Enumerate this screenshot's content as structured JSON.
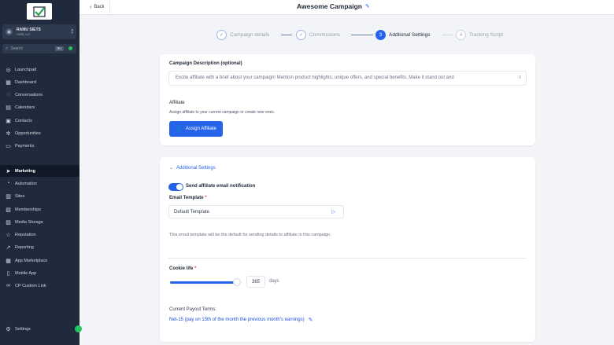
{
  "sidebar": {
    "account": {
      "name": "RAMU SIETS",
      "location": "Ariel, LA"
    },
    "search": {
      "placeholder": "Search",
      "shortcut": "⌘K"
    },
    "items": [
      {
        "label": "Launchpad",
        "icon": "rocket-icon",
        "glyph": "◎"
      },
      {
        "label": "Dashboard",
        "icon": "dashboard-icon",
        "glyph": "▦"
      },
      {
        "label": "Conversations",
        "icon": "chat-icon",
        "glyph": "◌"
      },
      {
        "label": "Calendars",
        "icon": "calendar-icon",
        "glyph": "▤"
      },
      {
        "label": "Contacts",
        "icon": "contacts-icon",
        "glyph": "▣"
      },
      {
        "label": "Opportunities",
        "icon": "opportunities-icon",
        "glyph": "✲"
      },
      {
        "label": "Payments",
        "icon": "payments-icon",
        "glyph": "▭"
      },
      {
        "label": "Marketing",
        "icon": "send-icon",
        "glyph": "➤"
      },
      {
        "label": "Automation",
        "icon": "automation-icon",
        "glyph": "◔"
      },
      {
        "label": "Sites",
        "icon": "sites-icon",
        "glyph": "▥"
      },
      {
        "label": "Memberships",
        "icon": "memberships-icon",
        "glyph": "▧"
      },
      {
        "label": "Media Storage",
        "icon": "media-icon",
        "glyph": "▨"
      },
      {
        "label": "Reputation",
        "icon": "star-icon",
        "glyph": "☆"
      },
      {
        "label": "Reporting",
        "icon": "chart-icon",
        "glyph": "↗"
      },
      {
        "label": "App Marketplace",
        "icon": "marketplace-icon",
        "glyph": "▦"
      },
      {
        "label": "Mobile App",
        "icon": "mobile-icon",
        "glyph": "▯"
      },
      {
        "label": "CP Custom Link",
        "icon": "link-icon",
        "glyph": "∞"
      }
    ],
    "settings": {
      "label": "Settings",
      "icon": "gear-icon",
      "glyph": "⚙"
    }
  },
  "topbar": {
    "back_label": "Back",
    "title": "Awesome Campaign"
  },
  "stepper": [
    {
      "label": "Campaign details",
      "state": "done",
      "marker": "✓"
    },
    {
      "label": "Commissions",
      "state": "done",
      "marker": "✓"
    },
    {
      "label": "Addtional Settings",
      "state": "current",
      "marker": "3"
    },
    {
      "label": "Tracking Script",
      "state": "pending",
      "marker": "4"
    }
  ],
  "description": {
    "label": "Campaign Description (optional)",
    "placeholder": "Excite affiliate with a brief about your campaign! Mention product highlights, unique offers, and special benefits. Make it stand out and",
    "count": "0"
  },
  "affiliate": {
    "label": "Affiliate",
    "subtitle": "Assign affiliate to your current campaign or create new ones.",
    "button_label": "Assign Affiliate"
  },
  "additional": {
    "toggle_label": "Additional Settings",
    "notify_label": "Send affiliate email notification",
    "notify_enabled": true,
    "template_label": "Email Template",
    "required_mark": "*",
    "template_value": "Default Template",
    "help_text": "This email template will be the default for sending details to affiliate in this campaign.",
    "cookie_label": "Cookie life",
    "cookie_value": "365",
    "cookie_unit": "days",
    "payout_label": "Current Payout Terms:",
    "payout_value": "Net-15 (pay on 15th of the month the previous month's earnings)"
  },
  "colors": {
    "accent": "#2563eb",
    "sidebar": "#1f2b3d",
    "success": "#22c55e"
  }
}
